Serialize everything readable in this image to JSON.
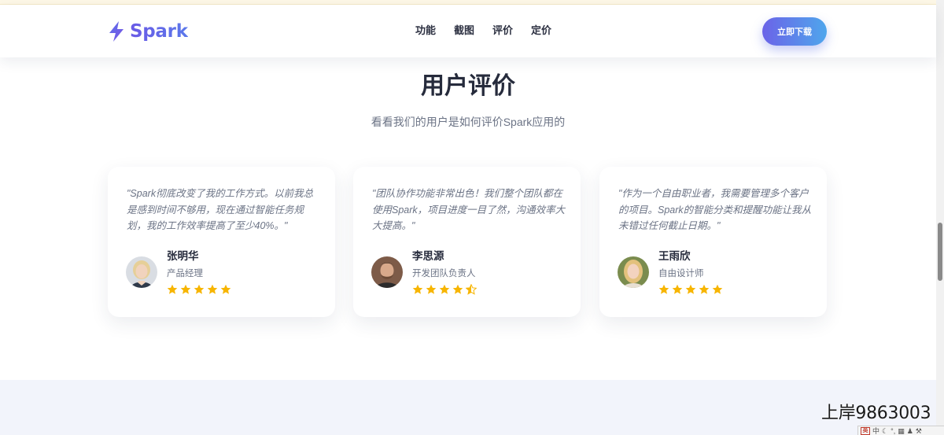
{
  "header": {
    "logo_text": "Spark",
    "nav": [
      "功能",
      "截图",
      "评价",
      "定价"
    ],
    "cta_label": "立即下载"
  },
  "section": {
    "title": "用户评价",
    "subtitle": "看看我们的用户是如何评价Spark应用的"
  },
  "testimonials": [
    {
      "quote": "\"Spark彻底改变了我的工作方式。以前我总是感到时间不够用，现在通过智能任务规划，我的工作效率提高了至少40%。\"",
      "name": "张明华",
      "role": "产品经理",
      "rating": 5
    },
    {
      "quote": "\"团队协作功能非常出色！我们整个团队都在使用Spark，项目进度一目了然，沟通效率大大提高。\"",
      "name": "李思源",
      "role": "开发团队负责人",
      "rating": 4.5
    },
    {
      "quote": "\"作为一个自由职业者，我需要管理多个客户的项目。Spark的智能分类和提醒功能让我从未错过任何截止日期。\"",
      "name": "王雨欣",
      "role": "自由设计师",
      "rating": 5
    }
  ],
  "overlay": {
    "text": "上岸9863003",
    "ime": {
      "badge": "英",
      "mode": "中"
    }
  },
  "colors": {
    "brand": "#6d5ce8",
    "cta_start": "#6b63e8",
    "cta_end": "#4fa6ec",
    "star": "#f7b500",
    "text_dark": "#262b3c",
    "text_muted": "#6b7385",
    "band": "#f2f4fb"
  }
}
